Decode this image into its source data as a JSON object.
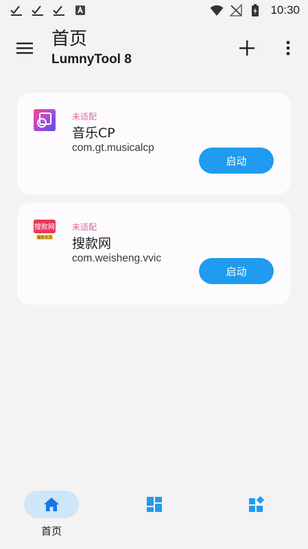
{
  "status_bar": {
    "time": "10:30",
    "icons": [
      "check-notification-icon",
      "check-notification-icon",
      "check-notification-icon",
      "app-a-icon",
      "wifi-icon",
      "no-signal-icon",
      "battery-charging-icon"
    ]
  },
  "app_bar": {
    "title": "首页",
    "subtitle": "LumnyTool 8",
    "icons": {
      "menu": "menu-icon",
      "add": "plus-icon",
      "more": "more-vert-icon"
    }
  },
  "apps": [
    {
      "status": "未适配",
      "name": "音乐CP",
      "package": "com.gt.musicalcp",
      "launch_label": "启动",
      "icon": "musicalcp-app-icon"
    },
    {
      "status": "未适配",
      "name": "搜款网",
      "package": "com.weisheng.vvic",
      "launch_label": "启动",
      "icon": "vvic-app-icon",
      "icon_text_top": "搜款网",
      "icon_text_bottom": "爆款发源"
    }
  ],
  "bottom_nav": {
    "items": [
      {
        "label": "首页",
        "icon": "home-icon",
        "selected": true
      },
      {
        "label": "",
        "icon": "dashboard-icon",
        "selected": false
      },
      {
        "label": "",
        "icon": "widgets-icon",
        "selected": false
      }
    ]
  },
  "colors": {
    "accent": "#1f9bf0",
    "status_text": "#e0679b",
    "nav_selected_bg": "#cfe6f8",
    "background": "#f3f3f3",
    "card": "#fdfbfd"
  }
}
